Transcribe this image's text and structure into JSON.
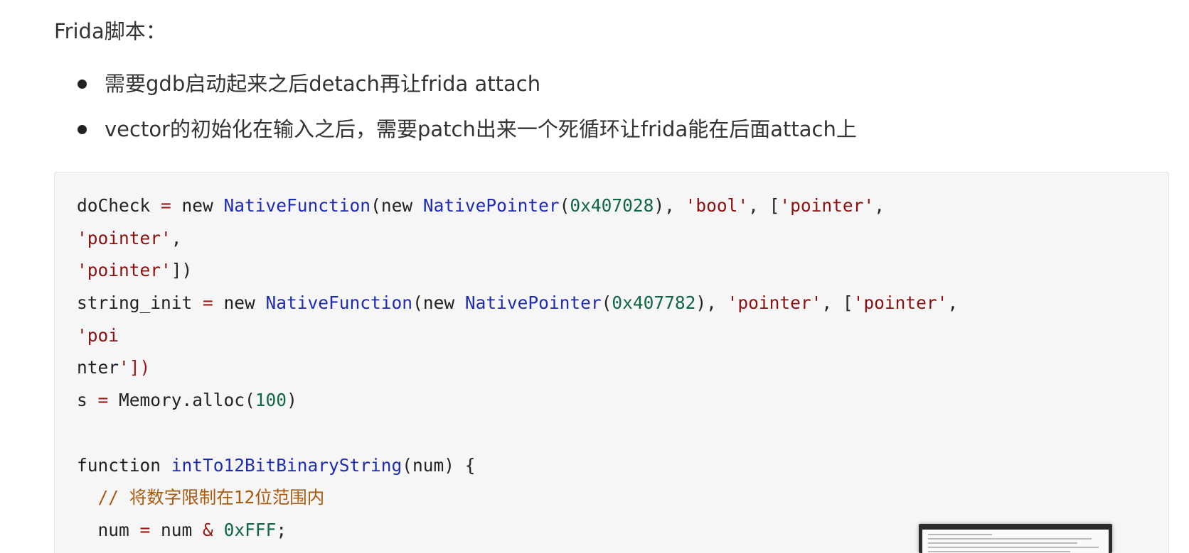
{
  "heading": "Frida脚本：",
  "bullets": [
    "需要gdb启动起来之后detach再让frida attach",
    "vector的初始化在输入之后，需要patch出来一个死循环让frida能在后面attach上"
  ],
  "code_lines": [
    [
      {
        "t": "doCheck ",
        "c": "plain"
      },
      {
        "t": "=",
        "c": "op"
      },
      {
        "t": " new ",
        "c": "kw"
      },
      {
        "t": "NativeFunction",
        "c": "class"
      },
      {
        "t": "(new ",
        "c": "plain"
      },
      {
        "t": "NativePointer",
        "c": "class"
      },
      {
        "t": "(",
        "c": "plain"
      },
      {
        "t": "0x407028",
        "c": "num"
      },
      {
        "t": "), ",
        "c": "plain"
      },
      {
        "t": "'bool'",
        "c": "str"
      },
      {
        "t": ", [",
        "c": "plain"
      },
      {
        "t": "'pointer'",
        "c": "str"
      },
      {
        "t": ",",
        "c": "plain"
      }
    ],
    [
      {
        "t": "'pointer'",
        "c": "str"
      },
      {
        "t": ",",
        "c": "plain"
      }
    ],
    [
      {
        "t": "'pointer'",
        "c": "str"
      },
      {
        "t": "])",
        "c": "plain"
      }
    ],
    [
      {
        "t": "string_init ",
        "c": "plain"
      },
      {
        "t": "=",
        "c": "op"
      },
      {
        "t": " new ",
        "c": "kw"
      },
      {
        "t": "NativeFunction",
        "c": "class"
      },
      {
        "t": "(new ",
        "c": "plain"
      },
      {
        "t": "NativePointer",
        "c": "class"
      },
      {
        "t": "(",
        "c": "plain"
      },
      {
        "t": "0x407782",
        "c": "num"
      },
      {
        "t": "), ",
        "c": "plain"
      },
      {
        "t": "'pointer'",
        "c": "str"
      },
      {
        "t": ", [",
        "c": "plain"
      },
      {
        "t": "'pointer'",
        "c": "str"
      },
      {
        "t": ",",
        "c": "plain"
      }
    ],
    [
      {
        "t": "'poi",
        "c": "str"
      }
    ],
    [
      {
        "t": "nter",
        "c": "plain"
      },
      {
        "t": "'",
        "c": "str"
      },
      {
        "t": "])",
        "c": "op"
      }
    ],
    [
      {
        "t": "s ",
        "c": "plain"
      },
      {
        "t": "=",
        "c": "op"
      },
      {
        "t": " Memory.alloc(",
        "c": "plain"
      },
      {
        "t": "100",
        "c": "num"
      },
      {
        "t": ")",
        "c": "plain"
      }
    ],
    [],
    [
      {
        "t": "function ",
        "c": "kw"
      },
      {
        "t": "intTo12BitBinaryString",
        "c": "fn"
      },
      {
        "t": "(num) {",
        "c": "plain"
      }
    ],
    [
      {
        "t": "  ",
        "c": "plain"
      },
      {
        "t": "// 将数字限制在12位范围内",
        "c": "comment"
      }
    ],
    [
      {
        "t": "  num ",
        "c": "plain"
      },
      {
        "t": "=",
        "c": "op"
      },
      {
        "t": " num ",
        "c": "plain"
      },
      {
        "t": "&",
        "c": "op"
      },
      {
        "t": " ",
        "c": "plain"
      },
      {
        "t": "0xFFF",
        "c": "num"
      },
      {
        "t": ";",
        "c": "plain"
      }
    ]
  ],
  "colors": {
    "text": "#333333",
    "code_background": "#f6f6f6",
    "class_name": "#1f2bb0",
    "string": "#8a1111",
    "number": "#116644",
    "comment": "#a85a0e",
    "operator": "#981a1a"
  }
}
